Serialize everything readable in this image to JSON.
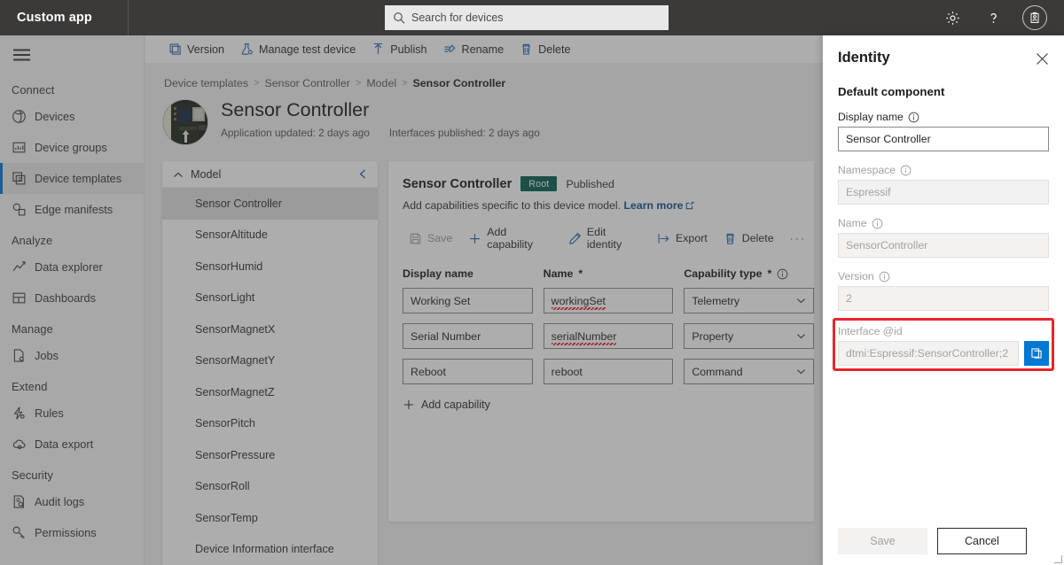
{
  "topbar": {
    "brand": "Custom app",
    "search_placeholder": "Search for devices",
    "search_icon": "search-icon",
    "settings_icon": "gear-icon",
    "help_icon": "question-mark-icon",
    "account_icon": "account-badge-icon"
  },
  "sidebar": {
    "menu_icon": "hamburger-icon",
    "groups": [
      {
        "label": "Connect",
        "items": [
          {
            "label": "Devices",
            "icon": "devices-icon",
            "selected": false
          },
          {
            "label": "Device groups",
            "icon": "device-groups-icon",
            "selected": false
          },
          {
            "label": "Device templates",
            "icon": "device-templates-icon",
            "selected": true
          },
          {
            "label": "Edge manifests",
            "icon": "edge-manifests-icon",
            "selected": false
          }
        ]
      },
      {
        "label": "Analyze",
        "items": [
          {
            "label": "Data explorer",
            "icon": "data-explorer-icon",
            "selected": false
          },
          {
            "label": "Dashboards",
            "icon": "dashboards-icon",
            "selected": false
          }
        ]
      },
      {
        "label": "Manage",
        "items": [
          {
            "label": "Jobs",
            "icon": "jobs-icon",
            "selected": false
          }
        ]
      },
      {
        "label": "Extend",
        "items": [
          {
            "label": "Rules",
            "icon": "rules-icon",
            "selected": false
          },
          {
            "label": "Data export",
            "icon": "data-export-icon",
            "selected": false
          }
        ]
      },
      {
        "label": "Security",
        "items": [
          {
            "label": "Audit logs",
            "icon": "audit-logs-icon",
            "selected": false
          },
          {
            "label": "Permissions",
            "icon": "permissions-key-icon",
            "selected": false
          }
        ]
      }
    ]
  },
  "command_bar": {
    "items": [
      {
        "label": "Version",
        "icon": "version-copy-icon"
      },
      {
        "label": "Manage test device",
        "icon": "test-device-flask-icon"
      },
      {
        "label": "Publish",
        "icon": "publish-up-arrow-icon"
      },
      {
        "label": "Rename",
        "icon": "rename-icon"
      },
      {
        "label": "Delete",
        "icon": "trash-icon"
      }
    ]
  },
  "breadcrumb": {
    "items": [
      "Device templates",
      "Sensor Controller",
      "Model",
      "Sensor Controller"
    ],
    "separator": ">"
  },
  "page_header": {
    "title": "Sensor Controller",
    "avatar_icon": "device-board-photo",
    "meta": [
      "Application updated: 2 days ago",
      "Interfaces published: 2 days ago"
    ]
  },
  "model_tree": {
    "header": "Model",
    "expand_icon": "chevron-up-icon",
    "collapse_icon": "chevron-left-icon",
    "items": [
      {
        "label": "Sensor Controller",
        "selected": true
      },
      {
        "label": "SensorAltitude",
        "selected": false
      },
      {
        "label": "SensorHumid",
        "selected": false
      },
      {
        "label": "SensorLight",
        "selected": false
      },
      {
        "label": "SensorMagnetX",
        "selected": false
      },
      {
        "label": "SensorMagnetY",
        "selected": false
      },
      {
        "label": "SensorMagnetZ",
        "selected": false
      },
      {
        "label": "SensorPitch",
        "selected": false
      },
      {
        "label": "SensorPressure",
        "selected": false
      },
      {
        "label": "SensorRoll",
        "selected": false
      },
      {
        "label": "SensorTemp",
        "selected": false
      },
      {
        "label": "Device Information interface",
        "selected": false
      }
    ]
  },
  "capability_card": {
    "title": "Sensor Controller",
    "badge": "Root",
    "badge_color": "#025f52",
    "status": "Published",
    "subtitle": "Add capabilities specific to this device model.",
    "learn_more": "Learn more",
    "external_icon": "external-link-icon",
    "commands": [
      {
        "label": "Save",
        "icon": "save-disk-icon",
        "disabled": true
      },
      {
        "label": "Add capability",
        "icon": "plus-icon",
        "disabled": false
      },
      {
        "label": "Edit identity",
        "icon": "pencil-icon",
        "disabled": false
      },
      {
        "label": "Export",
        "icon": "export-arrow-icon",
        "disabled": false
      },
      {
        "label": "Delete",
        "icon": "trash-icon",
        "disabled": false
      },
      {
        "label": "···",
        "icon": "more-ellipsis-icon",
        "disabled": false
      }
    ],
    "columns": [
      {
        "label": "Display name",
        "required": false,
        "info": false
      },
      {
        "label": "Name",
        "required": true,
        "info": false
      },
      {
        "label": "Capability type",
        "required": true,
        "info": true
      }
    ],
    "rows": [
      {
        "display_name": "Working Set",
        "name": "workingSet",
        "spellcheck_error": true,
        "capability_type": "Telemetry"
      },
      {
        "display_name": "Serial Number",
        "name": "serialNumber",
        "spellcheck_error": true,
        "capability_type": "Property"
      },
      {
        "display_name": "Reboot",
        "name": "reboot",
        "spellcheck_error": false,
        "capability_type": "Command"
      }
    ],
    "add_capability": "Add capability",
    "add_icon": "plus-icon"
  },
  "identity_panel": {
    "title": "Identity",
    "close_icon": "close-icon",
    "section": "Default component",
    "info_icon": "info-circle-icon",
    "fields": [
      {
        "label": "Display name",
        "value": "Sensor Controller",
        "disabled": false,
        "info": true
      },
      {
        "label": "Namespace",
        "value": "Espressif",
        "disabled": true,
        "info": true
      },
      {
        "label": "Name",
        "value": "SensorController",
        "disabled": true,
        "info": true
      },
      {
        "label": "Version",
        "value": "2",
        "disabled": true,
        "info": true
      }
    ],
    "interface_id": {
      "label": "Interface @id",
      "value": "dtmi:Espressif:SensorController;2",
      "disabled": true,
      "copy_icon": "copy-icon",
      "copy_color": "#0078d4",
      "highlight_color": "#e8262c"
    },
    "save_label": "Save",
    "save_disabled": true,
    "cancel_label": "Cancel"
  }
}
